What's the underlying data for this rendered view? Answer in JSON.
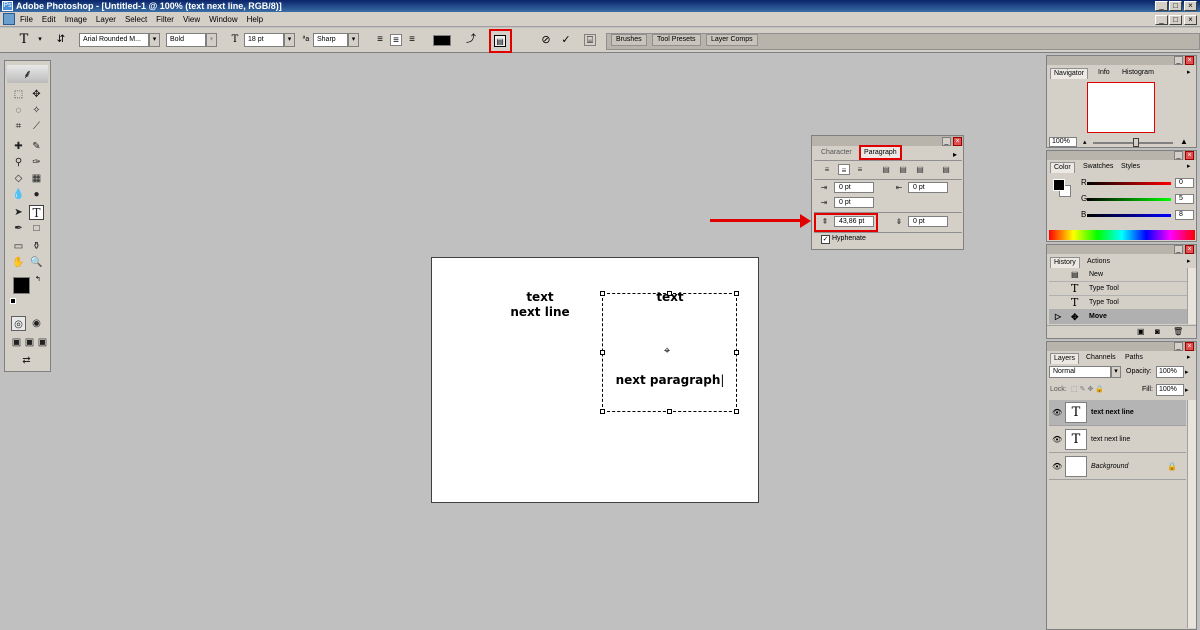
{
  "window": {
    "title": "Adobe Photoshop - [Untitled-1 @ 100% (text  next line, RGB/8)]"
  },
  "menu": [
    "File",
    "Edit",
    "Image",
    "Layer",
    "Select",
    "Filter",
    "View",
    "Window",
    "Help"
  ],
  "options": {
    "font_family": "Arial Rounded M...",
    "font_style": "Bold",
    "font_size": "18 pt",
    "antialias": "Sharp",
    "palette_wells": [
      "Brushes",
      "Tool Presets",
      "Layer Comps"
    ]
  },
  "canvas": {
    "text1_line1": "text",
    "text1_line2": "next line",
    "text2_line1": "text",
    "text2_line2": "next paragraph"
  },
  "paragraph_panel": {
    "tab_character": "Character",
    "tab_paragraph": "Paragraph",
    "indent_left": "0 pt",
    "indent_right": "0 pt",
    "indent_first": "0 pt",
    "space_before": "43,86 pt",
    "space_after": "0 pt",
    "hyphenate": "Hyphenate"
  },
  "navigator": {
    "tabs": [
      "Navigator",
      "Info",
      "Histogram"
    ],
    "zoom": "100%"
  },
  "color": {
    "tabs": [
      "Color",
      "Swatches",
      "Styles"
    ],
    "r_label": "R",
    "g_label": "G",
    "b_label": "B",
    "r": "0",
    "g": "5",
    "b": "8"
  },
  "history": {
    "tabs": [
      "History",
      "Actions"
    ],
    "items": [
      "New",
      "Type Tool",
      "Type Tool",
      "Move"
    ]
  },
  "layers": {
    "tabs": [
      "Layers",
      "Channels",
      "Paths"
    ],
    "blend": "Normal",
    "opacity_label": "Opacity:",
    "opacity": "100%",
    "lock_label": "Lock:",
    "fill_label": "Fill:",
    "fill": "100%",
    "rows": [
      "text  next line",
      "text next line",
      "Background"
    ]
  },
  "colors": {
    "highlight": "#e00000",
    "titlebar": "#0a246a"
  }
}
